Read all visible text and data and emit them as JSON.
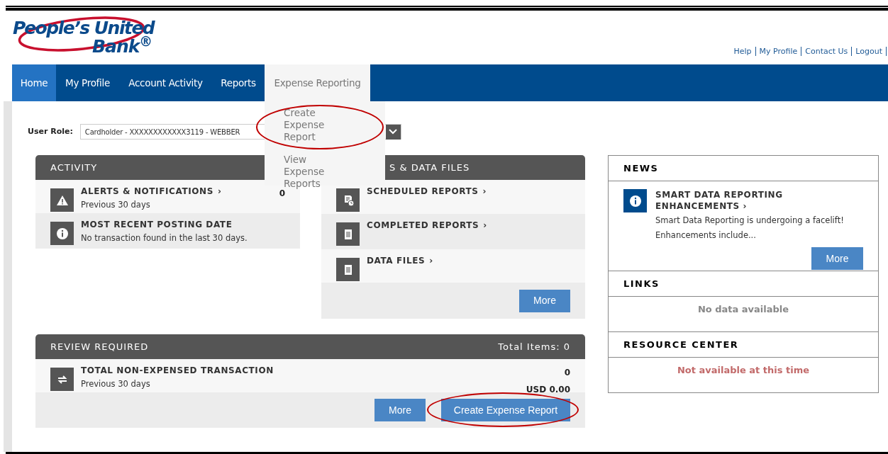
{
  "header": {
    "logo": {
      "line1": "People’s United",
      "line2": "Bank$^{®}$"
    },
    "links": [
      "Help",
      "My Profile",
      "Contact Us",
      "Logout"
    ]
  },
  "nav": {
    "tabs": [
      {
        "label": "Home",
        "selected": true,
        "open": false
      },
      {
        "label": "My Profile",
        "selected": false,
        "open": false
      },
      {
        "label": "Account Activity",
        "selected": false,
        "open": false
      },
      {
        "label": "Reports",
        "selected": false,
        "open": false
      },
      {
        "label": "Expense Reporting",
        "selected": false,
        "open": true
      }
    ],
    "menu": [
      {
        "label": "Create Expense Report",
        "highlighted": true
      },
      {
        "label": "View Expense Reports",
        "highlighted": false
      }
    ]
  },
  "user_role": {
    "label": "User Role:",
    "value": "Cardholder - XXXXXXXXXXXX3119 - WEBBER"
  },
  "activity": {
    "title": "ACTIVITY",
    "rows": [
      {
        "kind": "warning",
        "title": "ALERTS & NOTIFICATIONS",
        "arrow": "›",
        "subtitle": "Previous 30 days",
        "count": "0"
      },
      {
        "kind": "info",
        "title": "MOST RECENT POSTING DATE",
        "subtitle": "No transaction found in the last 30 days."
      }
    ]
  },
  "reports": {
    "title": "S & DATA FILES",
    "rows": [
      {
        "kind": "scheduled",
        "title": "SCHEDULED REPORTS",
        "arrow": "›"
      },
      {
        "kind": "document",
        "title": "COMPLETED REPORTS",
        "arrow": "›"
      },
      {
        "kind": "document",
        "title": "DATA FILES",
        "arrow": "›"
      }
    ],
    "button": "More"
  },
  "review": {
    "title": "REVIEW REQUIRED",
    "total": "Total Items: 0",
    "rows": [
      {
        "kind": "transfer",
        "title": "TOTAL NON-EXPENSED TRANSACTION",
        "subtitle": "Previous 30 days",
        "count": "0",
        "amount": "USD 0.00"
      }
    ],
    "buttons": [
      {
        "label": "More",
        "highlighted": false
      },
      {
        "label": "Create Expense Report",
        "highlighted": true
      }
    ]
  },
  "news": {
    "title": "NEWS",
    "item": {
      "title": "SMART DATA REPORTING ENHANCEMENTS",
      "arrow": "›",
      "lines": [
        "Smart Data Reporting is undergoing a facelift!",
        "Enhancements include..."
      ]
    },
    "button": "More"
  },
  "links": {
    "title": "LINKS",
    "message": "No data available"
  },
  "resource_center": {
    "title": "RESOURCE CENTER",
    "message": "Not available at this time"
  }
}
